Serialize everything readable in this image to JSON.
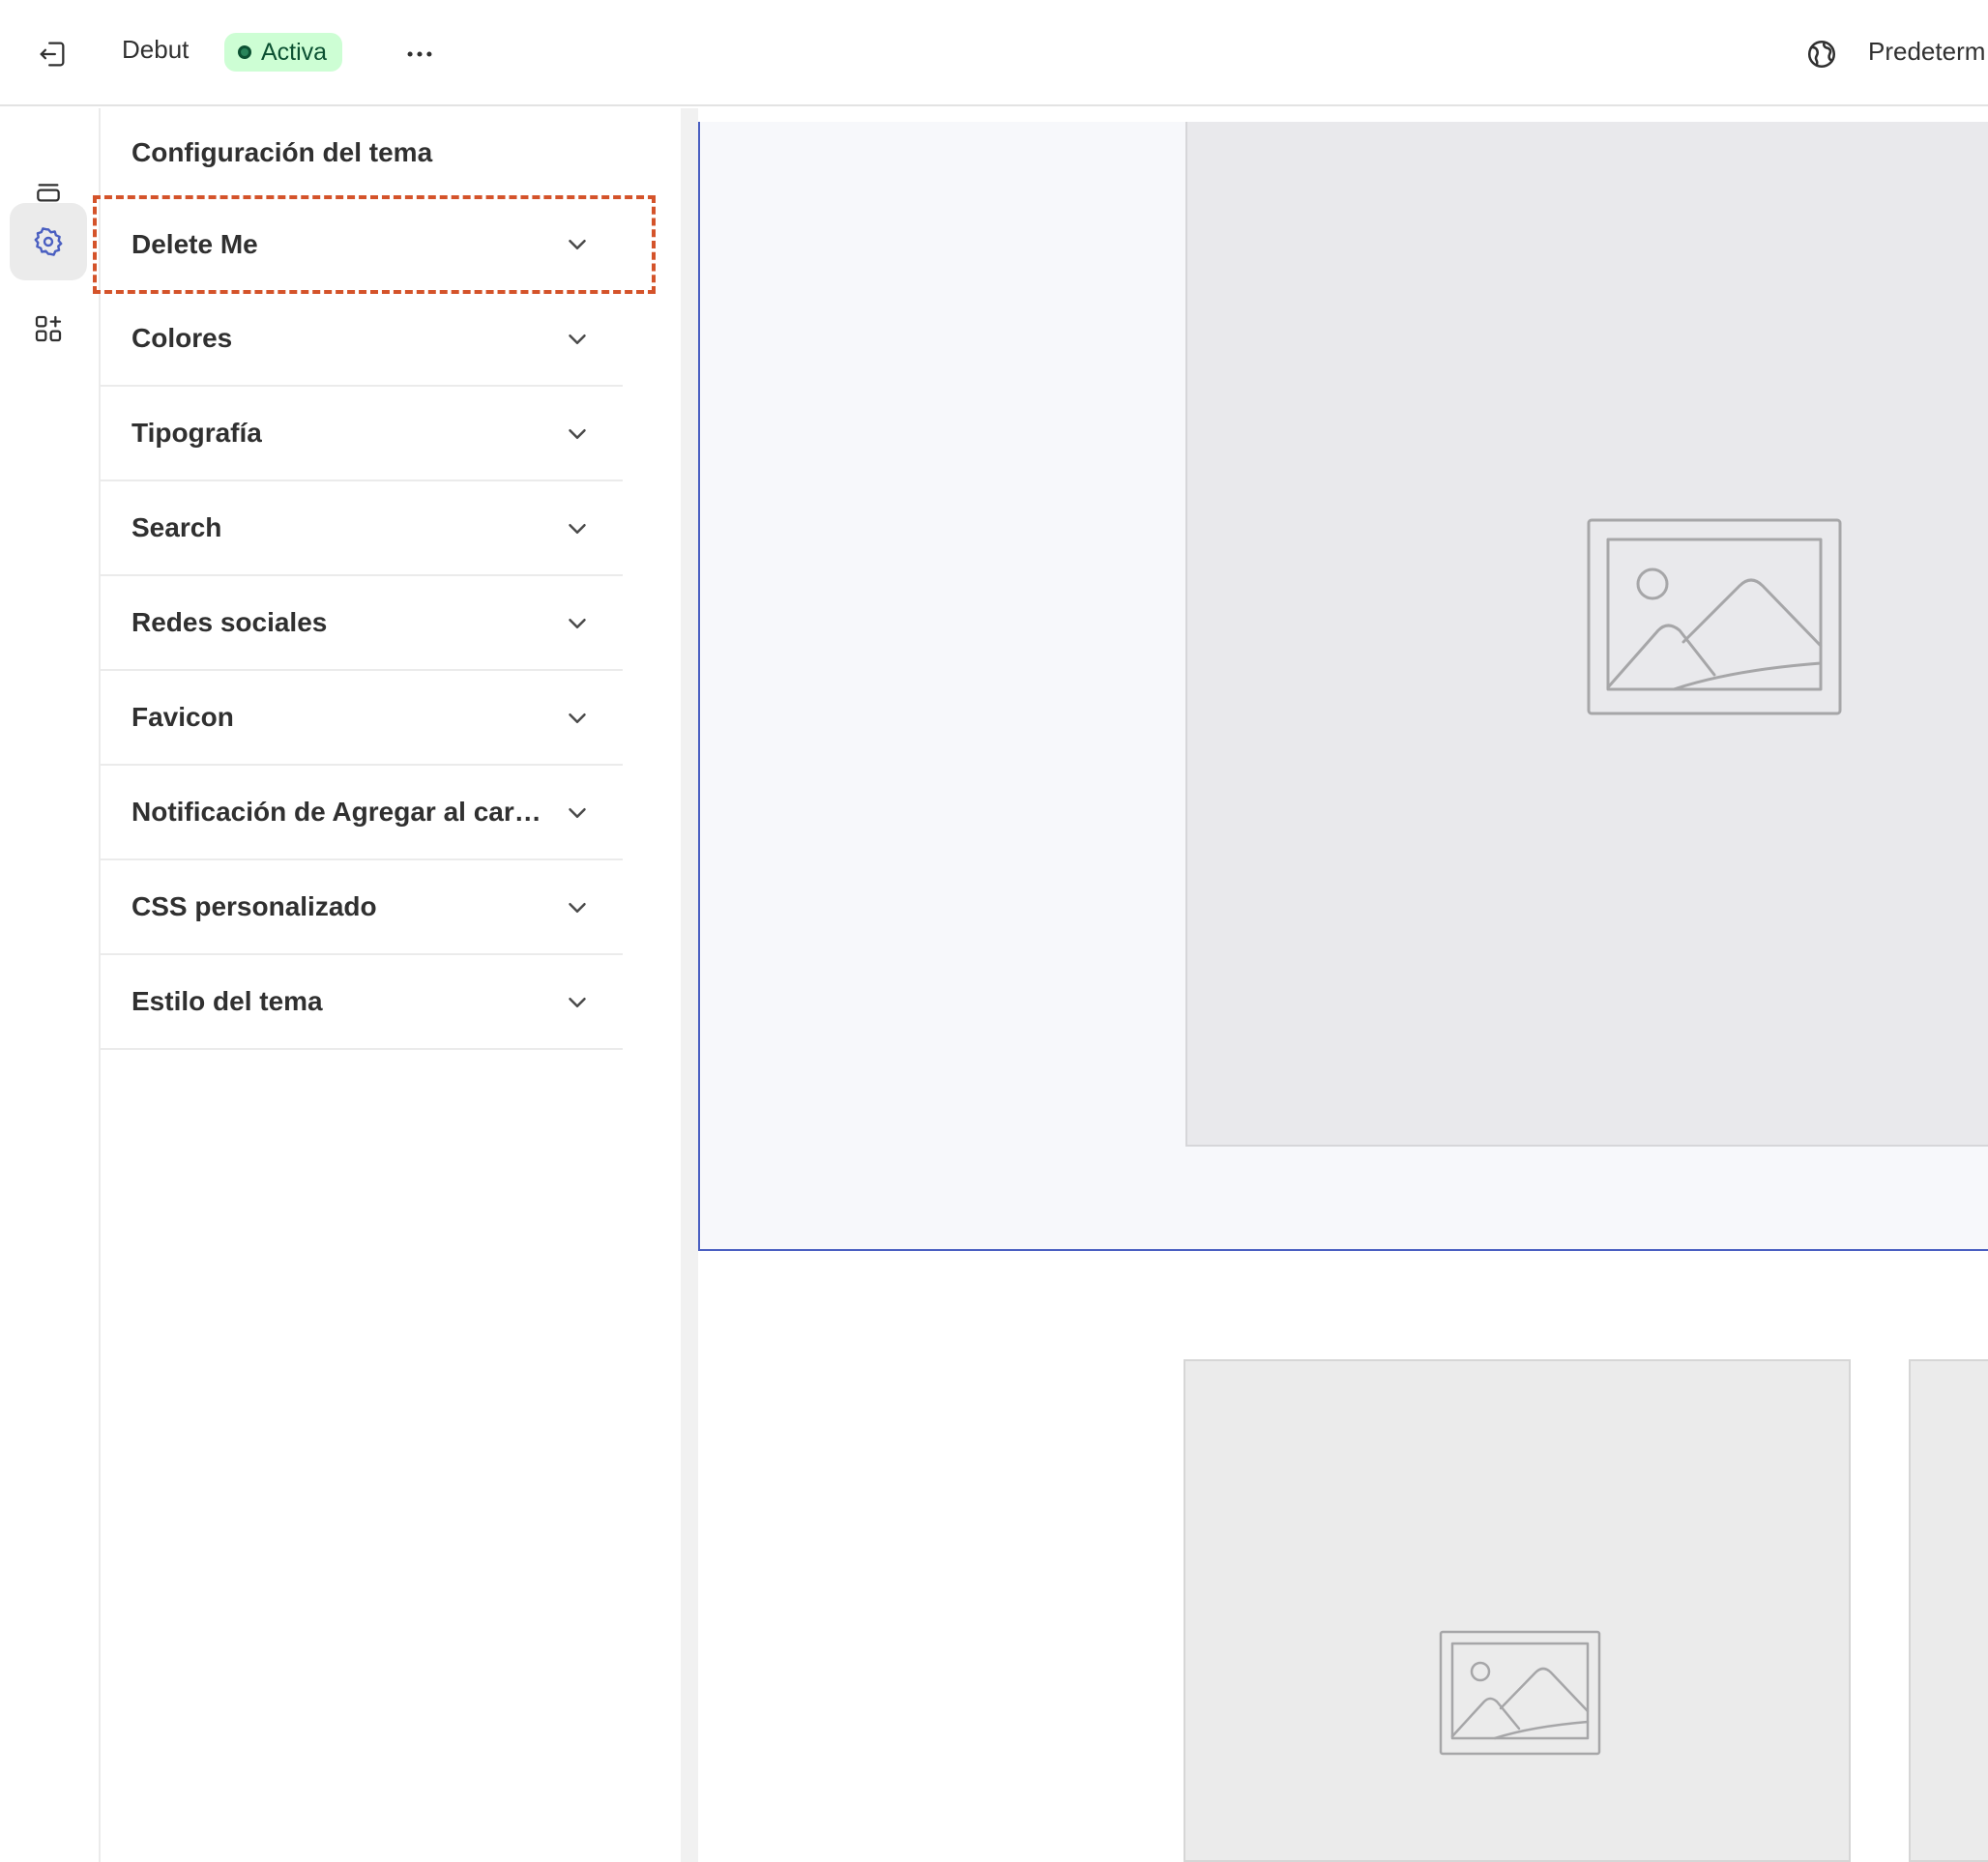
{
  "topbar": {
    "theme_name": "Debut",
    "status_label": "Activa",
    "locale_label": "Predeterm"
  },
  "panel": {
    "title": "Configuración del tema",
    "items": [
      {
        "label": "Delete Me"
      },
      {
        "label": "Colores"
      },
      {
        "label": "Tipografía"
      },
      {
        "label": "Search"
      },
      {
        "label": "Redes sociales"
      },
      {
        "label": "Favicon"
      },
      {
        "label": "Notificación de Agregar al car…"
      },
      {
        "label": "CSS personalizado"
      },
      {
        "label": "Estilo del tema"
      }
    ]
  },
  "icons": {
    "exit": "exit-icon",
    "more": "more-horizontal-icon",
    "globe": "globe-icon",
    "sections": "sections-icon",
    "settings": "gear-icon",
    "apps": "apps-add-icon",
    "chevron": "chevron-down-icon",
    "image_placeholder": "image-placeholder-icon"
  },
  "colors": {
    "accent": "#4a5fc1",
    "highlight": "#d4532a",
    "badge_bg": "#cdfed4",
    "badge_text": "#0c5132"
  }
}
